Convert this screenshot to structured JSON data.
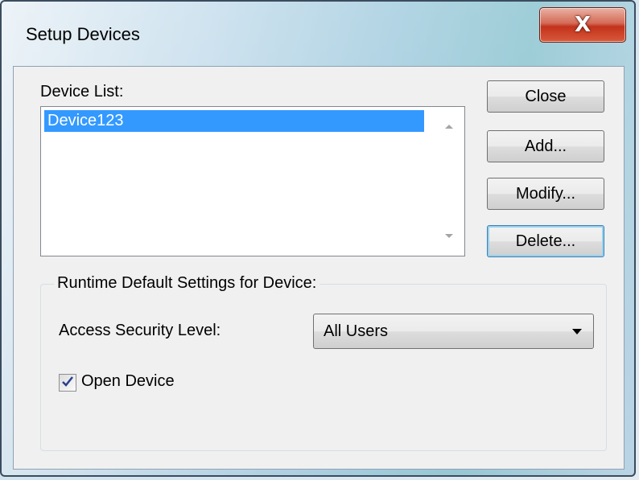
{
  "window": {
    "title": "Setup Devices",
    "close_glyph": "X"
  },
  "device_list": {
    "label": "Device List:",
    "items": [
      "Device123"
    ],
    "selected_index": 0
  },
  "buttons": {
    "close": "Close",
    "add": "Add...",
    "modify": "Modify...",
    "delete": "Delete..."
  },
  "runtime": {
    "group_title": "Runtime Default Settings for Device:",
    "access_label": "Access Security Level:",
    "access_value": "All Users",
    "open_device_label": "Open Device",
    "open_device_checked": true
  },
  "colors": {
    "selection": "#3399ff",
    "close_button": "#c2321c"
  }
}
